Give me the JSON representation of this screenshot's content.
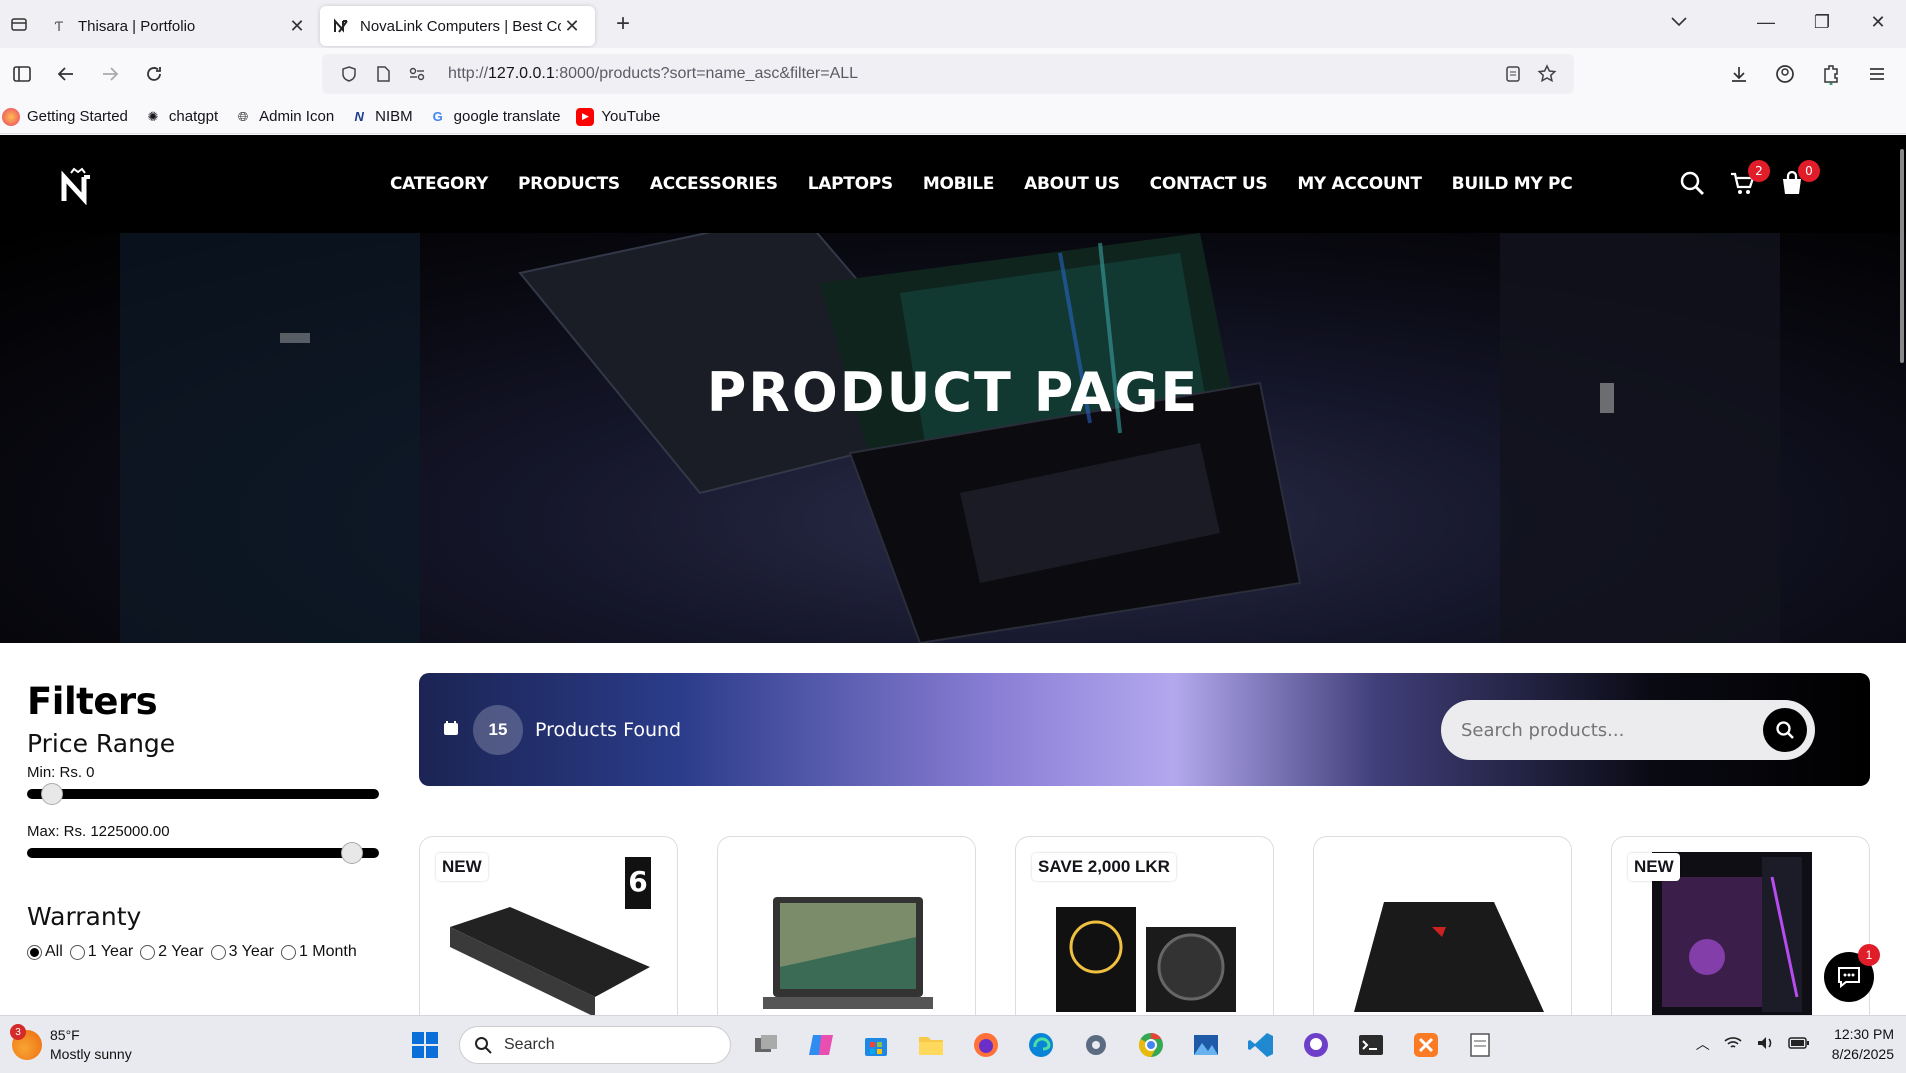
{
  "browser": {
    "tabs": [
      {
        "title": "Thisara | Portfolio",
        "active": false
      },
      {
        "title": "NovaLink Computers | Best Co",
        "active": true
      }
    ],
    "url_prefix": "http://",
    "url_host": "127.0.0.1",
    "url_rest": ":8000/products?sort=name_asc&filter=ALL",
    "bookmarks": [
      {
        "label": "Getting Started",
        "icon": "firefox-icon"
      },
      {
        "label": "chatgpt",
        "icon": "openai-icon"
      },
      {
        "label": "Admin Icon",
        "icon": "globe-icon"
      },
      {
        "label": "NIBM",
        "icon": "nibm-icon"
      },
      {
        "label": "google translate",
        "icon": "google-icon"
      },
      {
        "label": "YouTube",
        "icon": "youtube-icon"
      }
    ]
  },
  "site": {
    "nav": [
      "CATEGORY",
      "PRODUCTS",
      "ACCESSORIES",
      "LAPTOPS",
      "MOBILE",
      "ABOUT US",
      "CONTACT US",
      "MY ACCOUNT",
      "BUILD MY PC"
    ],
    "cart_count": "2",
    "bag_count": "0",
    "hero_title": "PRODUCT PAGE",
    "filters": {
      "title": "Filters",
      "price_title": "Price Range",
      "min_label": "Min: Rs. 0",
      "max_label": "Max: Rs. 1225000.00",
      "min_fraction": 0.0,
      "max_fraction": 1.0,
      "warranty_title": "Warranty",
      "warranty_options": [
        "All",
        "1 Year",
        "2 Year",
        "3 Year",
        "1 Month"
      ],
      "warranty_selected": "All"
    },
    "results": {
      "count": "15",
      "label": "Products Found",
      "search_placeholder": "Search products..."
    },
    "products": [
      {
        "tag": "NEW",
        "name": "external-hdd-enclosure",
        "badge_text": "6"
      },
      {
        "tag": "",
        "name": "acer-laptop"
      },
      {
        "tag": "SAVE 2,000 LKR",
        "name": "rgb-fan-kit"
      },
      {
        "tag": "",
        "name": "gaming-laptop"
      },
      {
        "tag": "NEW",
        "name": "gaming-pc-tower"
      }
    ],
    "chat_badge": "1"
  },
  "taskbar": {
    "weather_badge": "3",
    "temp": "85°F",
    "condition": "Mostly sunny",
    "search_label": "Search",
    "time": "12:30 PM",
    "date": "8/26/2025"
  },
  "colors": {
    "accent_red": "#e11d2a",
    "header_bg": "#000000"
  }
}
